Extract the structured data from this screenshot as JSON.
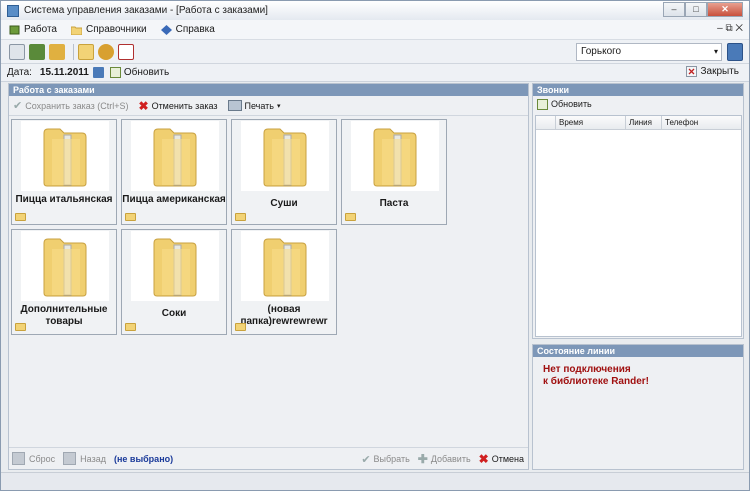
{
  "window": {
    "title": "Система управления заказами - [Работа с заказами]",
    "min": "–",
    "max": "□",
    "close": "✕"
  },
  "menu": {
    "items": [
      {
        "label": "Работа"
      },
      {
        "label": "Справочники"
      },
      {
        "label": "Справка"
      }
    ],
    "right": "– ⧉ ✕"
  },
  "toolbar": {
    "store": "Горького"
  },
  "datebar": {
    "date_label": "Дата:",
    "date_value": "15.11.2011",
    "refresh_label": "Обновить",
    "close_label": "Закрыть"
  },
  "orders": {
    "header": "Работа с заказами",
    "save_label": "Сохранить заказ (Ctrl+S)",
    "cancel_label": "Отменить заказ",
    "print_label": "Печать",
    "tiles": [
      {
        "label": "Пицца итальянская"
      },
      {
        "label": "Пицца американская"
      },
      {
        "label": "Суши"
      },
      {
        "label": "Паста"
      },
      {
        "label": "Дополнительные товары"
      },
      {
        "label": "Соки"
      },
      {
        "label": "(новая папка)rewrewrewr"
      }
    ],
    "reset_label": "Сброс",
    "back_label": "Назад",
    "selection": "(не выбрано)",
    "choose_label": "Выбрать",
    "add_label": "Добавить",
    "cancel_bottom_label": "Отмена"
  },
  "calls": {
    "header": "Звонки",
    "refresh_label": "Обновить",
    "columns": [
      "Время",
      "Линия",
      "Телефон"
    ]
  },
  "line_status": {
    "header": "Состояние линии",
    "message_line1": "Нет подключения",
    "message_line2": "к библиотеке Rander!"
  }
}
